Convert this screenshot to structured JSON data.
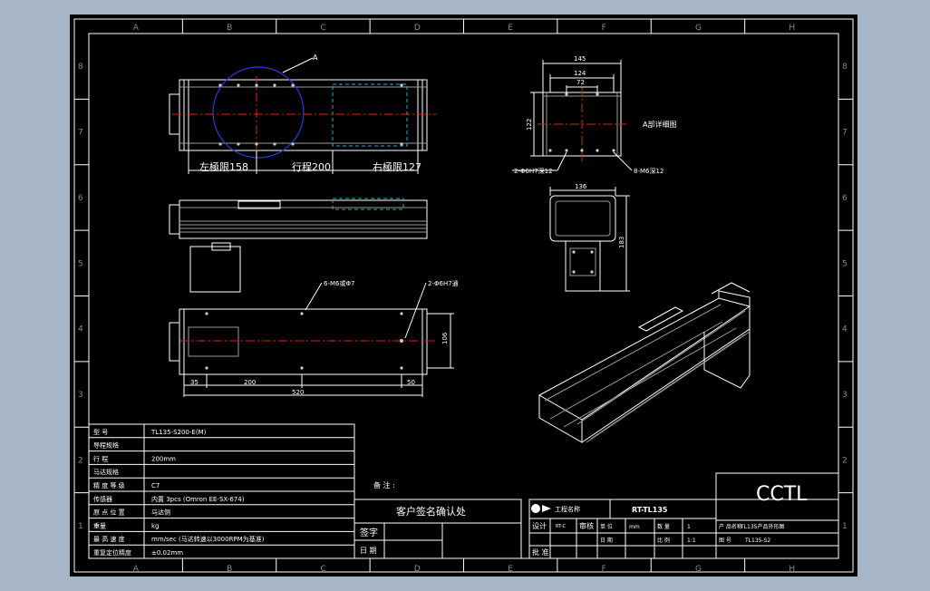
{
  "grid": {
    "columns": [
      "A",
      "B",
      "C",
      "D",
      "E",
      "F",
      "G",
      "H"
    ],
    "rows": [
      "8",
      "7",
      "6",
      "5",
      "4",
      "3",
      "2",
      "1"
    ]
  },
  "callouts": {
    "detail_a": "A",
    "detail_a_label": "A部详细图",
    "left_limit": "左極限158",
    "travel": "行程200",
    "right_limit": "右極限127",
    "hole_left": "2-Φ6H7深12",
    "hole_right": "8-M6深12",
    "hole_top1": "6-M6或Φ7",
    "hole_top2": "2-Φ6H7通"
  },
  "dims": {
    "d145": "145",
    "d124": "124",
    "d72": "72",
    "d122": "122",
    "d136": "136",
    "d183": "183",
    "d35": "35",
    "d200": "200",
    "d520": "520",
    "d50": "50",
    "d106": "106"
  },
  "spec_table": {
    "rows": [
      {
        "label": "型 号",
        "value": "TL135-S200-E(M)"
      },
      {
        "label": "导程规格",
        "value": ""
      },
      {
        "label": "行 程",
        "value": "200mm"
      },
      {
        "label": "马达规格",
        "value": ""
      },
      {
        "label": "精 度 等 级",
        "value": "C7"
      },
      {
        "label": "传感器",
        "value": "内置 3pcs (Omron EE-SX-674)"
      },
      {
        "label": "原 点 位 置",
        "value": "马达侧"
      },
      {
        "label": "重量",
        "value": "kg"
      },
      {
        "label": "最 高 速 度",
        "value": "mm/sec (马达转速以3000RPM为基准)"
      },
      {
        "label": "重复定位精度",
        "value": "±0.02mm"
      }
    ]
  },
  "notes_label": "备 注 :",
  "confirm": {
    "title": "客户签名确认处",
    "sign": "签字",
    "date": "日 期"
  },
  "title_block": {
    "project_label": "工程名称",
    "project_value": "RT-TL135",
    "brand": "CCTL",
    "design": "设计",
    "check": "审核",
    "approve": "批 准",
    "design_val": "RT-C",
    "ratio_label": "比 例",
    "ratio_val": "1:1",
    "qty_label": "数 量",
    "qty_val": "1",
    "product_label": "产 品名称",
    "product_val": "TL135产品外形图",
    "drawing_label": "图 号",
    "drawing_val": "TL135-S2",
    "unit_label": "单 位",
    "unit_val": "mm",
    "date2": "日 期"
  }
}
